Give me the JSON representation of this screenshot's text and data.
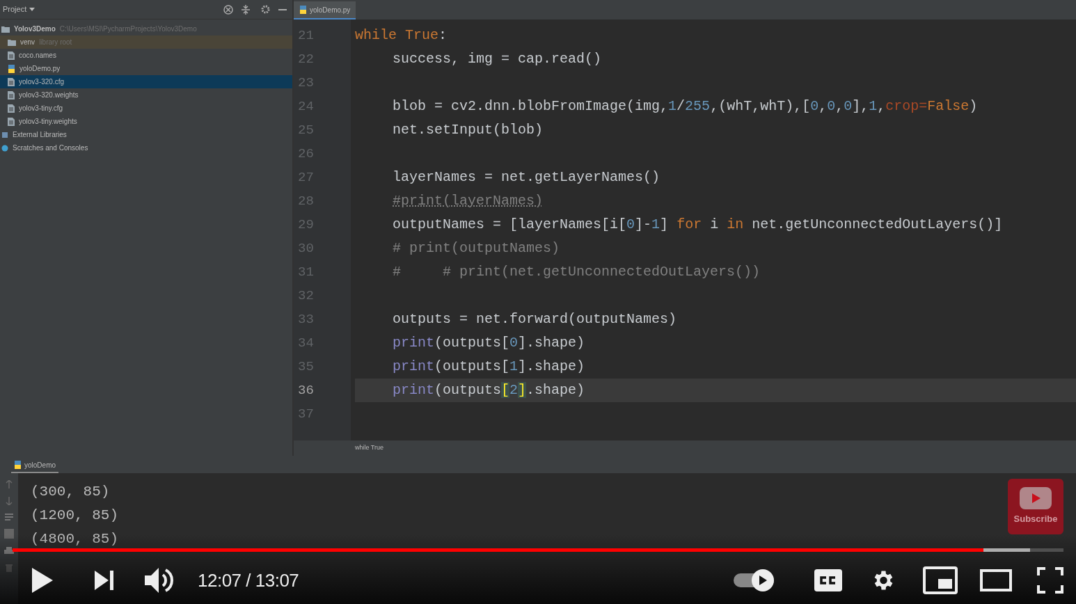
{
  "project_panel": {
    "title": "Project",
    "tree": [
      {
        "label": "Yolov3Demo",
        "note": "C:\\Users\\MSI\\PycharmProjects\\Yolov3Demo",
        "kind": "project",
        "selected": false,
        "children": [
          {
            "label": "venv",
            "note": "library root",
            "kind": "library",
            "selected": false
          },
          {
            "label": "coco.names",
            "kind": "file",
            "selected": false
          },
          {
            "label": "yoloDemo.py",
            "kind": "python",
            "selected": false
          },
          {
            "label": "yolov3-320.cfg",
            "kind": "file",
            "selected": true
          },
          {
            "label": "yolov3-320.weights",
            "kind": "file",
            "selected": false
          },
          {
            "label": "yolov3-tiny.cfg",
            "kind": "file",
            "selected": false
          },
          {
            "label": "yolov3-tiny.weights",
            "kind": "file",
            "selected": false
          }
        ]
      },
      {
        "label": "External Libraries",
        "kind": "external",
        "selected": false
      },
      {
        "label": "Scratches and Consoles",
        "kind": "scratches",
        "selected": false
      }
    ]
  },
  "editor": {
    "tabs": [
      {
        "label": "yoloDemo.py",
        "selected": true
      }
    ],
    "lines": [
      {
        "number": "21",
        "current": false,
        "tokens": [
          {
            "kind": "keyword",
            "text": "while True"
          },
          {
            "kind": "plain",
            "text": ":"
          }
        ],
        "children": [
          {
            "number": "22",
            "current": false,
            "tokens": [
              {
                "kind": "plain",
                "text": "success, img = cap.read()"
              }
            ]
          },
          {
            "number": "23",
            "current": false
          },
          {
            "number": "24",
            "current": false,
            "tokens": [
              {
                "kind": "plain",
                "text": "blob = cv2.dnn.blobFromImage(img,"
              },
              {
                "kind": "number",
                "text": "1"
              },
              {
                "kind": "plain",
                "text": "/"
              },
              {
                "kind": "number",
                "text": "255"
              },
              {
                "kind": "plain",
                "text": ",(whT,whT),["
              },
              {
                "kind": "number",
                "text": "0"
              },
              {
                "kind": "plain",
                "text": ","
              },
              {
                "kind": "number",
                "text": "0"
              },
              {
                "kind": "plain",
                "text": ","
              },
              {
                "kind": "number",
                "text": "0"
              },
              {
                "kind": "plain",
                "text": "],"
              },
              {
                "kind": "number",
                "text": "1"
              },
              {
                "kind": "plain",
                "text": ","
              },
              {
                "kind": "param",
                "text": "crop="
              },
              {
                "kind": "keyword",
                "text": "False"
              },
              {
                "kind": "plain",
                "text": ")"
              }
            ]
          },
          {
            "number": "25",
            "current": false,
            "tokens": [
              {
                "kind": "plain",
                "text": "net.setInput(blob)"
              }
            ]
          },
          {
            "number": "26",
            "current": false
          },
          {
            "number": "27",
            "current": false,
            "tokens": [
              {
                "kind": "plain",
                "text": "layerNames = net.getLayerNames()"
              }
            ]
          },
          {
            "number": "28",
            "current": false,
            "tokens": [
              {
                "kind": "comment",
                "text": "#print(layerNames)"
              }
            ]
          },
          {
            "number": "29",
            "current": false,
            "tokens": [
              {
                "kind": "plain",
                "text": "outputNames = [layerNames[i["
              },
              {
                "kind": "number",
                "text": "0"
              },
              {
                "kind": "plain",
                "text": "]-"
              },
              {
                "kind": "number",
                "text": "1"
              },
              {
                "kind": "plain",
                "text": "] "
              },
              {
                "kind": "keyword",
                "text": "for"
              },
              {
                "kind": "plain",
                "text": " i "
              },
              {
                "kind": "keyword",
                "text": "in"
              },
              {
                "kind": "plain",
                "text": " net.getUnconnectedOutLayers()]"
              }
            ]
          },
          {
            "number": "30",
            "current": false,
            "tokens": [
              {
                "kind": "comment",
                "text": "# print(outputNames)"
              }
            ]
          },
          {
            "number": "31",
            "current": false,
            "tokens": [
              {
                "kind": "comment",
                "text": "#     # print(net.getUnconnectedOutLayers())"
              }
            ]
          },
          {
            "number": "32",
            "current": false
          },
          {
            "number": "33",
            "current": false,
            "tokens": [
              {
                "kind": "plain",
                "text": "outputs = net.forward(outputNames)"
              }
            ]
          },
          {
            "number": "34",
            "current": false,
            "tokens": [
              {
                "kind": "builtin",
                "text": "print"
              },
              {
                "kind": "plain",
                "text": "(outputs["
              },
              {
                "kind": "number",
                "text": "0"
              },
              {
                "kind": "plain",
                "text": "].shape)"
              }
            ]
          },
          {
            "number": "35",
            "current": false,
            "tokens": [
              {
                "kind": "builtin",
                "text": "print"
              },
              {
                "kind": "plain",
                "text": "(outputs["
              },
              {
                "kind": "number",
                "text": "1"
              },
              {
                "kind": "plain",
                "text": "].shape)"
              }
            ]
          },
          {
            "number": "36",
            "current": true,
            "tokens": [
              {
                "kind": "builtin",
                "text": "print"
              },
              {
                "kind": "plain",
                "text": "(outputs"
              },
              {
                "kind": "match",
                "text": "["
              },
              {
                "kind": "number",
                "text": "2"
              },
              {
                "kind": "match",
                "text": "]"
              },
              {
                "kind": "plain",
                "text": ".shape)"
              }
            ]
          },
          {
            "number": "37",
            "current": false
          }
        ]
      }
    ],
    "breadcrumb": "while True"
  },
  "run_panel": {
    "tabs": [
      {
        "label": "yoloDemo",
        "selected": true
      }
    ],
    "output": [
      "(300, 85)",
      "(1200, 85)",
      "(4800, 85)"
    ]
  },
  "player": {
    "subscribe": "Subscribe",
    "progress": {
      "level": 0.924
    },
    "buffered": {
      "level": 0.968
    },
    "time": "12:07 / 13:07",
    "autoplay": {
      "on": true
    }
  }
}
